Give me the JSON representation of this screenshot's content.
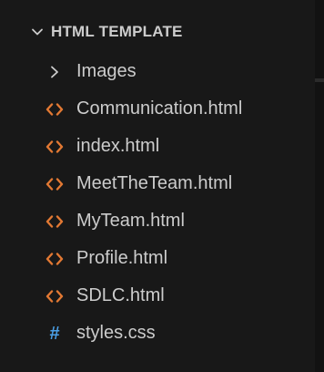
{
  "explorer": {
    "folder_title": "HTML TEMPLATE",
    "items": [
      {
        "label": "Images",
        "kind": "folder",
        "icon": "chevron-right-icon"
      },
      {
        "label": "Communication.html",
        "kind": "file",
        "icon": "html-file-icon"
      },
      {
        "label": "index.html",
        "kind": "file",
        "icon": "html-file-icon"
      },
      {
        "label": "MeetTheTeam.html",
        "kind": "file",
        "icon": "html-file-icon"
      },
      {
        "label": "MyTeam.html",
        "kind": "file",
        "icon": "html-file-icon"
      },
      {
        "label": "Profile.html",
        "kind": "file",
        "icon": "html-file-icon"
      },
      {
        "label": "SDLC.html",
        "kind": "file",
        "icon": "html-file-icon"
      },
      {
        "label": "styles.css",
        "kind": "file",
        "icon": "css-file-icon",
        "glyph": "#"
      }
    ]
  },
  "colors": {
    "background": "#181818",
    "text": "#cccccc",
    "html_icon": "#e37933",
    "css_icon": "#4a9fe6"
  }
}
